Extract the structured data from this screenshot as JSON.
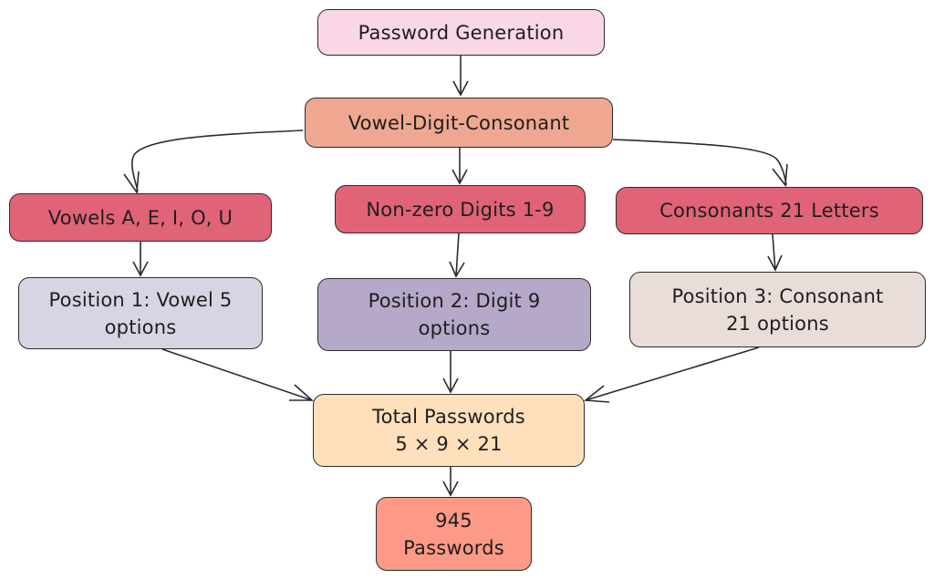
{
  "diagram": {
    "type": "flowchart",
    "colors": {
      "stroke": "#2b2b2b",
      "start": "#f9d7e6",
      "pattern": "#eea891",
      "category": "#e06377",
      "position_1": "#d7d5e3",
      "position_2": "#b6a8c9",
      "position_3": "#e8ddd8",
      "total": "#fee0bd",
      "result": "#fd9a87"
    },
    "nodes": {
      "start": {
        "lines": [
          "Password Generation"
        ]
      },
      "vdc": {
        "lines": [
          "Vowel-Digit-Consonant"
        ]
      },
      "vowels": {
        "lines": [
          "Vowels A, E, I, O, U"
        ]
      },
      "digits": {
        "lines": [
          "Non-zero Digits 1-9"
        ]
      },
      "cons": {
        "lines": [
          "Consonants 21 Letters"
        ]
      },
      "pos1": {
        "lines": [
          "Position 1: Vowel 5",
          "options"
        ]
      },
      "pos2": {
        "lines": [
          "Position 2: Digit 9",
          "options"
        ]
      },
      "pos3": {
        "lines": [
          "Position 3: Consonant",
          "21 options"
        ]
      },
      "total": {
        "lines": [
          "Total Passwords",
          "5 × 9 × 21"
        ]
      },
      "result": {
        "lines": [
          "945",
          "Passwords"
        ]
      }
    },
    "edges": [
      {
        "from": "start",
        "to": "vdc"
      },
      {
        "from": "vdc",
        "to": "vowels"
      },
      {
        "from": "vdc",
        "to": "digits"
      },
      {
        "from": "vdc",
        "to": "cons"
      },
      {
        "from": "vowels",
        "to": "pos1"
      },
      {
        "from": "digits",
        "to": "pos2"
      },
      {
        "from": "cons",
        "to": "pos3"
      },
      {
        "from": "pos1",
        "to": "total"
      },
      {
        "from": "pos2",
        "to": "total"
      },
      {
        "from": "pos3",
        "to": "total"
      },
      {
        "from": "total",
        "to": "result"
      }
    ]
  }
}
